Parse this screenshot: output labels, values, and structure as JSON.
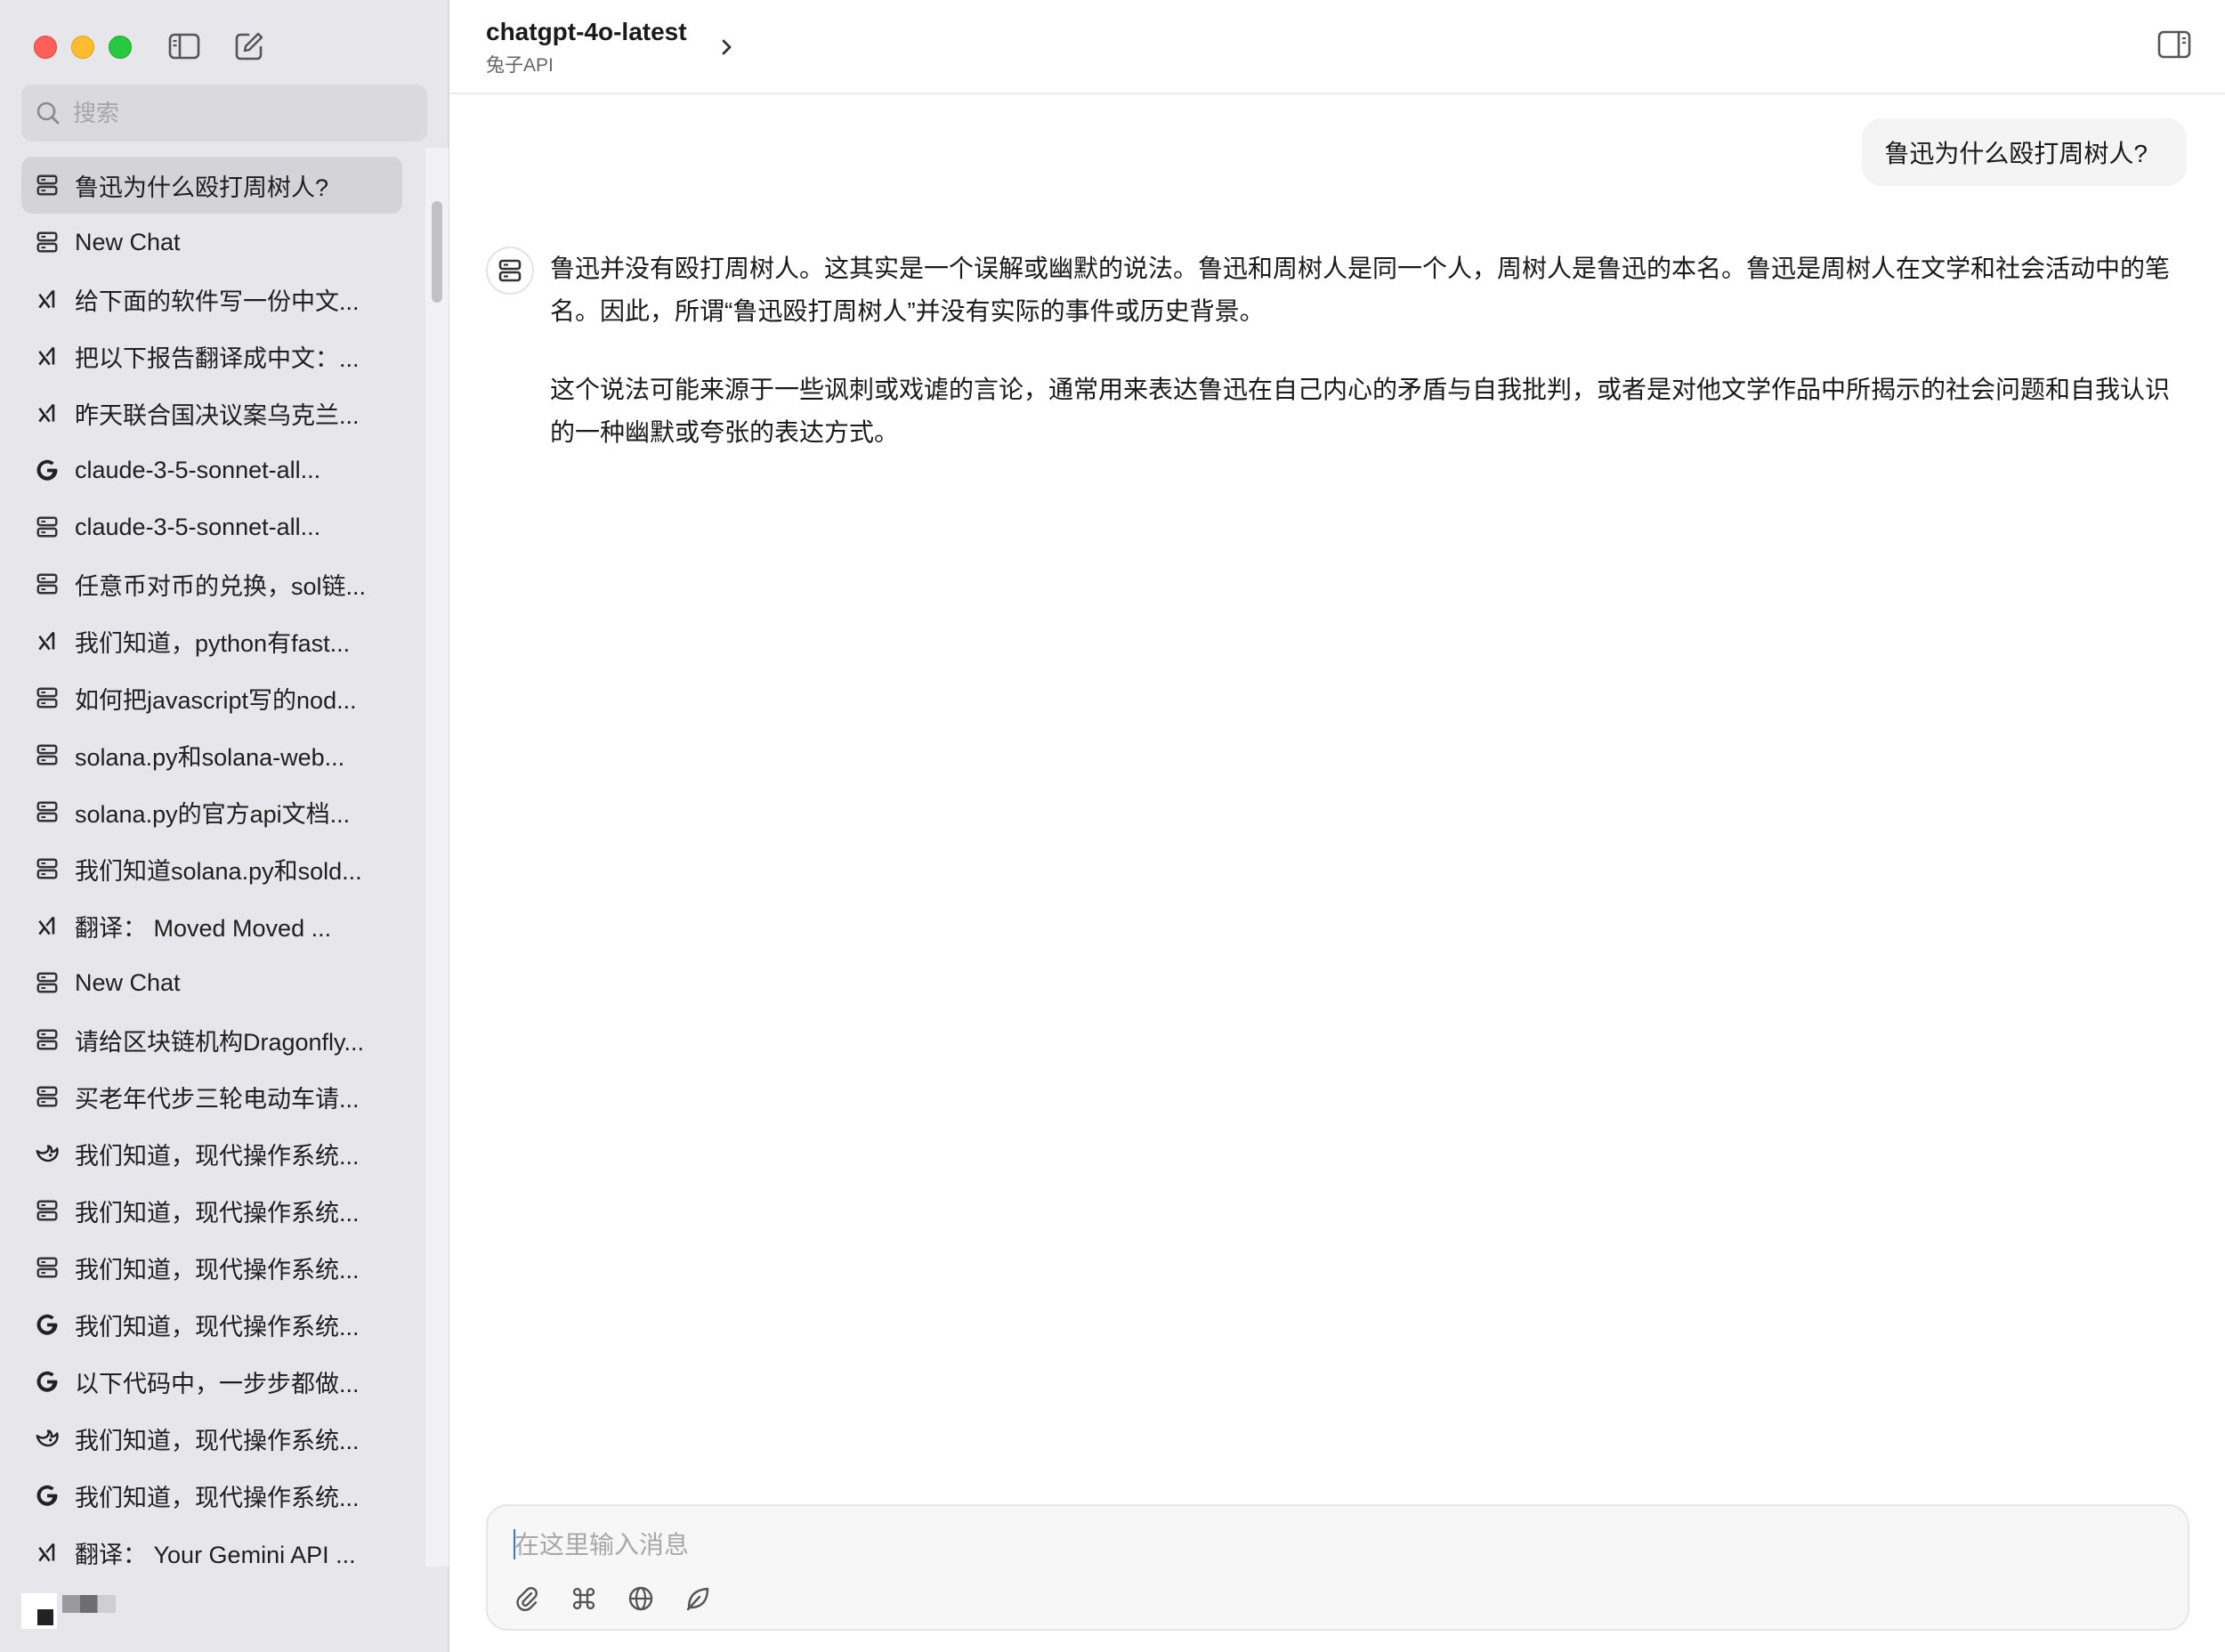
{
  "sidebar": {
    "search_placeholder": "搜索",
    "items": [
      {
        "label": "鲁迅为什么殴打周树人?",
        "icon": "server-icon",
        "active": true
      },
      {
        "label": "New Chat",
        "icon": "server-icon"
      },
      {
        "label": "给下面的软件写一份中文...",
        "icon": "xai-icon"
      },
      {
        "label": "把以下报告翻译成中文：...",
        "icon": "xai-icon"
      },
      {
        "label": "昨天联合国决议案乌克兰...",
        "icon": "xai-icon"
      },
      {
        "label": "claude-3-5-sonnet-all...",
        "icon": "google-icon"
      },
      {
        "label": "claude-3-5-sonnet-all...",
        "icon": "server-icon"
      },
      {
        "label": "任意币对币的兑换，sol链...",
        "icon": "server-icon"
      },
      {
        "label": "我们知道，python有fast...",
        "icon": "xai-icon"
      },
      {
        "label": "如何把javascript写的nod...",
        "icon": "server-icon"
      },
      {
        "label": "solana.py和solana-web...",
        "icon": "server-icon"
      },
      {
        "label": "solana.py的官方api文档...",
        "icon": "server-icon"
      },
      {
        "label": "我们知道solana.py和sold...",
        "icon": "server-icon"
      },
      {
        "label": "翻译： Moved Moved ...",
        "icon": "xai-icon"
      },
      {
        "label": "New Chat",
        "icon": "server-icon"
      },
      {
        "label": "请给区块链机构Dragonfly...",
        "icon": "server-icon"
      },
      {
        "label": "买老年代步三轮电动车请...",
        "icon": "server-icon"
      },
      {
        "label": "我们知道，现代操作系统...",
        "icon": "deepseek-icon"
      },
      {
        "label": "我们知道，现代操作系统...",
        "icon": "server-icon"
      },
      {
        "label": "我们知道，现代操作系统...",
        "icon": "server-icon"
      },
      {
        "label": "我们知道，现代操作系统...",
        "icon": "google-icon"
      },
      {
        "label": "以下代码中，一步步都做...",
        "icon": "google-icon"
      },
      {
        "label": "我们知道，现代操作系统...",
        "icon": "deepseek-icon"
      },
      {
        "label": "我们知道，现代操作系统...",
        "icon": "google-icon"
      },
      {
        "label": "翻译： Your Gemini API ...",
        "icon": "xai-icon"
      }
    ]
  },
  "header": {
    "model": "chatgpt-4o-latest",
    "provider": "兔子API"
  },
  "conversation": {
    "user_message": "鲁迅为什么殴打周树人?",
    "assistant_paragraphs": [
      "鲁迅并没有殴打周树人。这其实是一个误解或幽默的说法。鲁迅和周树人是同一个人，周树人是鲁迅的本名。鲁迅是周树人在文学和社会活动中的笔名。因此，所谓“鲁迅殴打周树人”并没有实际的事件或历史背景。",
      "这个说法可能来源于一些讽刺或戏谑的言论，通常用来表达鲁迅在自己内心的矛盾与自我批判，或者是对他文学作品中所揭示的社会问题和自我认识的一种幽默或夸张的表达方式。"
    ]
  },
  "composer": {
    "placeholder": "在这里输入消息",
    "tools": [
      "paperclip-icon",
      "command-icon",
      "globe-icon",
      "leaf-icon"
    ]
  }
}
